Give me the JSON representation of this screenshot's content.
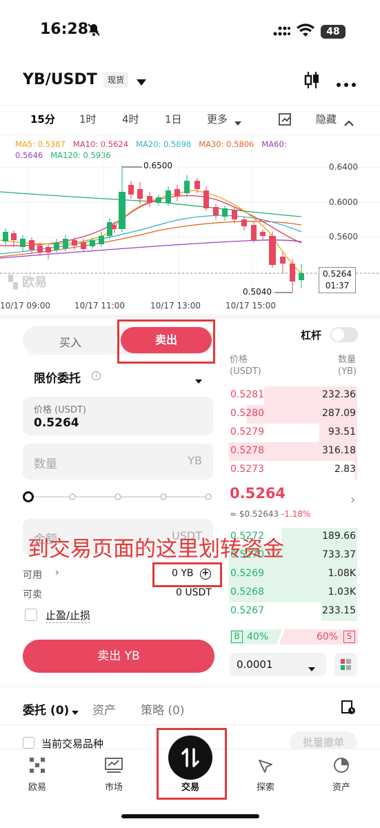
{
  "status_bar": {
    "time": "16:28",
    "battery": "48"
  },
  "header": {
    "pair": "YB/USDT",
    "badge": "现货"
  },
  "timeframes": [
    "15分",
    "1时",
    "4时",
    "1日",
    "更多",
    "隐藏"
  ],
  "ma_legend": {
    "ma5": "MA5: 0.5387",
    "ma10": "MA10: 0.5624",
    "ma20": "MA20: 0.5898",
    "ma30": "MA30: 0.5806",
    "ma60_label": "MA60:",
    "ma60_value": "0.5646",
    "ma120": "MA120: 0.5936"
  },
  "chart": {
    "price_ticks": [
      "0.6400",
      "0.6000",
      "0.5600"
    ],
    "high_label": "0.6500",
    "low_label": "0.5040",
    "current_price": "0.5264",
    "countdown": "01:37",
    "time_ticks": [
      "10/17 09:00",
      "10/17 11:00",
      "10/17 13:00",
      "10/17 15:00"
    ],
    "watermark": "欧易"
  },
  "trade": {
    "buy_tab": "买入",
    "sell_tab": "卖出",
    "leverage": "杠杆",
    "order_type": "限价委托",
    "price_label": "价格 (USDT)",
    "price_value": "0.5264",
    "qty_placeholder": "数量",
    "qty_unit": "YB",
    "amount_placeholder": "金额",
    "amount_unit": "USDT",
    "available_label": "可用",
    "available_value": "0 YB",
    "sellable_label": "可卖",
    "sellable_value": "0 USDT",
    "tpsl": "止盈/止损",
    "sell_button": "卖出 YB"
  },
  "orderbook": {
    "price_header": "价格",
    "price_unit": "(USDT)",
    "qty_header": "数量",
    "qty_unit": "(YB)",
    "asks": [
      {
        "price": "0.5281",
        "qty": "232.36"
      },
      {
        "price": "0.5280",
        "qty": "287.09"
      },
      {
        "price": "0.5279",
        "qty": "93.51"
      },
      {
        "price": "0.5278",
        "qty": "316.18"
      },
      {
        "price": "0.5273",
        "qty": "2.83"
      }
    ],
    "mid_price": "0.5264",
    "mid_sub": "≈ $0.52643",
    "mid_change": "-1.18%",
    "bids": [
      {
        "price": "0.5272",
        "qty": "189.66"
      },
      {
        "price": "0.5270",
        "qty": "733.37"
      },
      {
        "price": "0.5269",
        "qty": "1.08K"
      },
      {
        "price": "0.5268",
        "qty": "1.03K"
      },
      {
        "price": "0.5267",
        "qty": "233.15"
      }
    ],
    "buy_ratio_label": "B",
    "buy_ratio": "40%",
    "sell_ratio": "60%",
    "sell_ratio_label": "S",
    "precision": "0.0001"
  },
  "annotation": "到交易页面的这里划转资金",
  "orders": {
    "tab_orders": "委托 (0)",
    "tab_assets": "资产",
    "tab_strategy": "策略 (0)",
    "current_pair": "当前交易品种",
    "batch_cancel": "批量撤单"
  },
  "nav": [
    "欧易",
    "市场",
    "交易",
    "探索",
    "资产"
  ]
}
